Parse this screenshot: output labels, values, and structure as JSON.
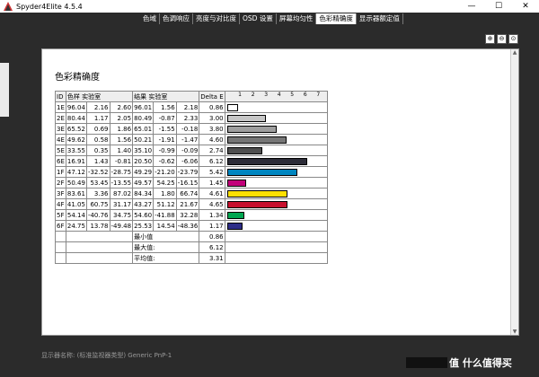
{
  "window": {
    "title": "Spyder4Elite 4.5.4",
    "minimize": "—",
    "maximize": "☐",
    "close": "✕"
  },
  "tabs": [
    {
      "label": "色域",
      "active": false
    },
    {
      "label": "色调响应",
      "active": false
    },
    {
      "label": "亮度与对比度",
      "active": false
    },
    {
      "label": "OSD 设置",
      "active": false
    },
    {
      "label": "屏幕均匀性",
      "active": false
    },
    {
      "label": "色彩精确度",
      "active": true
    },
    {
      "label": "显示器额定值",
      "active": false
    }
  ],
  "zoom_buttons": [
    "⊕",
    "⊖",
    "⊙"
  ],
  "panel": {
    "heading": "色彩精确度"
  },
  "table": {
    "headers": {
      "id": "ID",
      "sample": "色样 实验室",
      "result": "结果 实验室",
      "delta": "Delta E"
    },
    "scale": [
      "1",
      "2",
      "3",
      "4",
      "5",
      "6",
      "7"
    ],
    "rows": [
      {
        "id": "1E",
        "s": [
          "96.04",
          "2.16",
          "2.60"
        ],
        "r": [
          "96.01",
          "1.56",
          "2.18"
        ],
        "d": "0.86",
        "color": "#ffffff"
      },
      {
        "id": "2E",
        "s": [
          "80.44",
          "1.17",
          "2.05"
        ],
        "r": [
          "80.49",
          "-0.87",
          "2.33"
        ],
        "d": "3.00",
        "color": "#c6c6c6"
      },
      {
        "id": "3E",
        "s": [
          "65.52",
          "0.69",
          "1.86"
        ],
        "r": [
          "65.01",
          "-1.55",
          "-0.18"
        ],
        "d": "3.80",
        "color": "#9e9e9e"
      },
      {
        "id": "4E",
        "s": [
          "49.62",
          "0.58",
          "1.56"
        ],
        "r": [
          "50.21",
          "-1.91",
          "-1.47"
        ],
        "d": "4.60",
        "color": "#767676"
      },
      {
        "id": "5E",
        "s": [
          "33.55",
          "0.35",
          "1.40"
        ],
        "r": [
          "35.10",
          "-0.99",
          "-0.09"
        ],
        "d": "2.74",
        "color": "#4f4f4f"
      },
      {
        "id": "6E",
        "s": [
          "16.91",
          "1.43",
          "-0.81"
        ],
        "r": [
          "20.50",
          "-0.62",
          "-6.06"
        ],
        "d": "6.12",
        "color": "#2c2c38"
      },
      {
        "id": "1F",
        "s": [
          "47.12",
          "-32.52",
          "-28.75"
        ],
        "r": [
          "49.29",
          "-21.20",
          "-23.79"
        ],
        "d": "5.42",
        "color": "#0086c0"
      },
      {
        "id": "2F",
        "s": [
          "50.49",
          "53.45",
          "-13.55"
        ],
        "r": [
          "49.57",
          "54.25",
          "-16.15"
        ],
        "d": "1.45",
        "color": "#c2007a"
      },
      {
        "id": "3F",
        "s": [
          "83.61",
          "3.36",
          "87.02"
        ],
        "r": [
          "84.34",
          "1.80",
          "66.74"
        ],
        "d": "4.61",
        "color": "#ffe000"
      },
      {
        "id": "4F",
        "s": [
          "41.05",
          "60.75",
          "31.17"
        ],
        "r": [
          "43.27",
          "51.12",
          "21.67"
        ],
        "d": "4.65",
        "color": "#c8102e"
      },
      {
        "id": "5F",
        "s": [
          "54.14",
          "-40.76",
          "34.75"
        ],
        "r": [
          "54.60",
          "-41.88",
          "32.28"
        ],
        "d": "1.34",
        "color": "#00a650"
      },
      {
        "id": "6F",
        "s": [
          "24.75",
          "13.78",
          "-49.48"
        ],
        "r": [
          "25.53",
          "14.54",
          "-48.36"
        ],
        "d": "1.17",
        "color": "#2e2d88"
      }
    ],
    "summary": [
      {
        "label": "最小值",
        "value": "0.86"
      },
      {
        "label": "最大值:",
        "value": "6.12"
      },
      {
        "label": "平均值:",
        "value": "3.31"
      }
    ]
  },
  "status": {
    "label": "显示器名称: (标准监视器类型) Generic PnP-1"
  },
  "watermark": "值 什么值得买"
}
